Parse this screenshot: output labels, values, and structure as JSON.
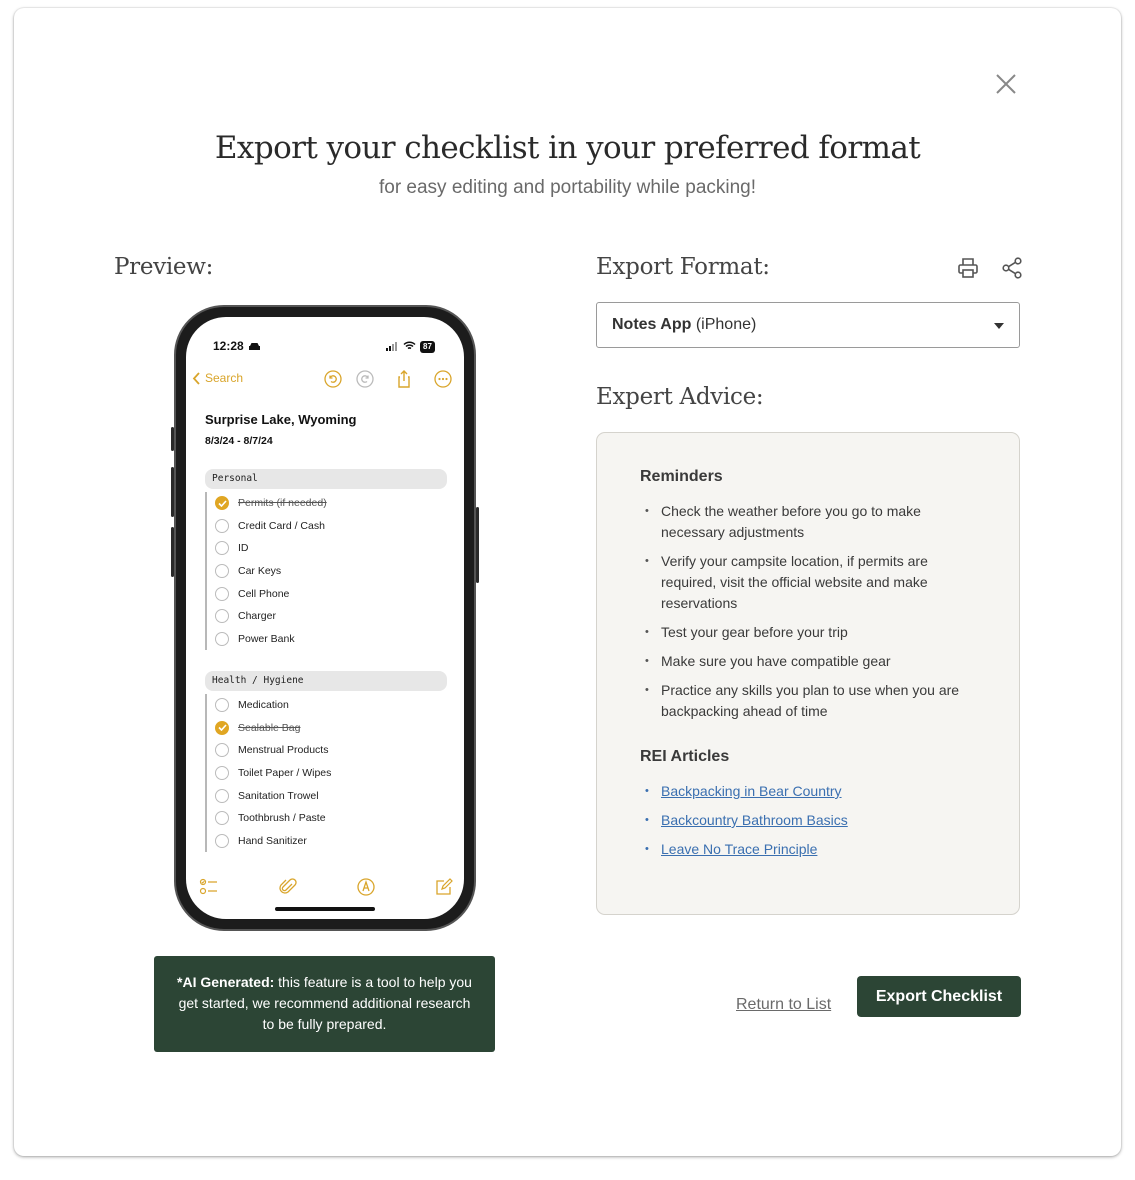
{
  "modal": {
    "title": "Export your checklist in your preferred format",
    "subtitle": "for easy editing and portability while packing!"
  },
  "preview": {
    "heading": "Preview:",
    "phone": {
      "status_time": "12:28",
      "battery": "87",
      "back_label": "Search",
      "note_title": "Surprise Lake, Wyoming",
      "note_dates": "8/3/24 - 8/7/24",
      "groups": [
        {
          "name": "Personal",
          "items": [
            {
              "label": "Permits (if needed)",
              "checked": true
            },
            {
              "label": "Credit Card / Cash",
              "checked": false
            },
            {
              "label": "ID",
              "checked": false
            },
            {
              "label": "Car Keys",
              "checked": false
            },
            {
              "label": "Cell Phone",
              "checked": false
            },
            {
              "label": "Charger",
              "checked": false
            },
            {
              "label": "Power Bank",
              "checked": false
            }
          ]
        },
        {
          "name": "Health / Hygiene",
          "items": [
            {
              "label": "Medication",
              "checked": false
            },
            {
              "label": "Sealable Bag",
              "checked": true
            },
            {
              "label": "Menstrual Products",
              "checked": false
            },
            {
              "label": "Toilet Paper / Wipes",
              "checked": false
            },
            {
              "label": "Sanitation Trowel",
              "checked": false
            },
            {
              "label": "Toothbrush / Paste",
              "checked": false
            },
            {
              "label": "Hand Sanitizer",
              "checked": false
            }
          ]
        }
      ]
    },
    "ai_note_bold": "*AI Generated:",
    "ai_note_text": " this feature is a tool to help you get started, we recommend additional research to be fully prepared."
  },
  "export": {
    "heading": "Export Format:",
    "format_selected_bold": "Notes App",
    "format_selected_rest": " (iPhone)",
    "print_icon": "printer-icon",
    "share_icon": "share-icon"
  },
  "advice": {
    "heading": "Expert Advice:",
    "reminders_heading": "Reminders",
    "reminders": [
      "Check the weather before you go to make necessary adjustments",
      "Verify your campsite location, if permits are required, visit the official website and make reservations",
      "Test your gear before your trip",
      "Make sure you have compatible gear",
      "Practice any skills you plan to use when you are backpacking ahead of time"
    ],
    "articles_heading": "REI Articles",
    "articles": [
      "Backpacking in Bear Country",
      "Backcountry Bathroom Basics",
      "Leave No Trace Principle"
    ]
  },
  "actions": {
    "return_label": "Return to List",
    "export_label": "Export Checklist"
  },
  "colors": {
    "accent_green": "#2c4535",
    "notes_yellow": "#e0a623",
    "link_blue": "#3a6fb0"
  }
}
